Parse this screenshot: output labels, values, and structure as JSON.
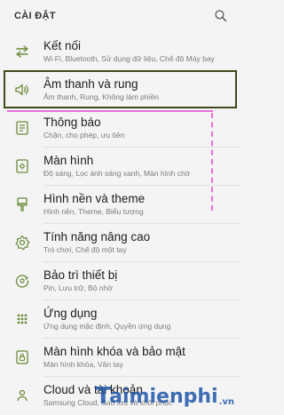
{
  "header": {
    "title": "CÀI ĐẶT",
    "search_icon": "search-icon"
  },
  "items": [
    {
      "title": "Kết nối",
      "subtitle": "Wi-Fi, Bluetooth, Sử dụng dữ liệu, Chế độ Máy bay",
      "icon": "connections-icon"
    },
    {
      "title": "Âm thanh và rung",
      "subtitle": "Âm thanh, Rung, Không làm phiền",
      "icon": "volume-icon"
    },
    {
      "title": "Thông báo",
      "subtitle": "Chặn, cho phép, ưu tiên",
      "icon": "notifications-icon"
    },
    {
      "title": "Màn hình",
      "subtitle": "Độ sáng, Lọc ánh sáng xanh, Màn hình chờ",
      "icon": "display-icon"
    },
    {
      "title": "Hình nền và theme",
      "subtitle": "Hình nền, Theme, Biểu tượng",
      "icon": "wallpaper-brush-icon"
    },
    {
      "title": "Tính năng nâng cao",
      "subtitle": "Trò chơi, Chế độ một tay",
      "icon": "advanced-features-icon"
    },
    {
      "title": "Bảo trì thiết bị",
      "subtitle": "Pin, Lưu trữ, Bộ nhớ",
      "icon": "device-maintenance-icon"
    },
    {
      "title": "Ứng dụng",
      "subtitle": "Ứng dụng mặc định, Quyền ứng dụng",
      "icon": "apps-icon"
    },
    {
      "title": "Màn hình khóa và bảo mật",
      "subtitle": "Màn hình khóa, Vân tay",
      "icon": "lock-screen-icon"
    },
    {
      "title": "Cloud và tài khoản",
      "subtitle": "Samsung Cloud, Sao lưu và khôi phục",
      "icon": "cloud-icon"
    }
  ],
  "selected_index": 1,
  "watermark": {
    "text": "aimienphi",
    "t": "T",
    "suffix": ".vn"
  },
  "colors": {
    "icon": "#6a8a38",
    "selected_border": "#3e4a1a",
    "overlay": "#e86fd8",
    "watermark": "#1e56a8"
  }
}
